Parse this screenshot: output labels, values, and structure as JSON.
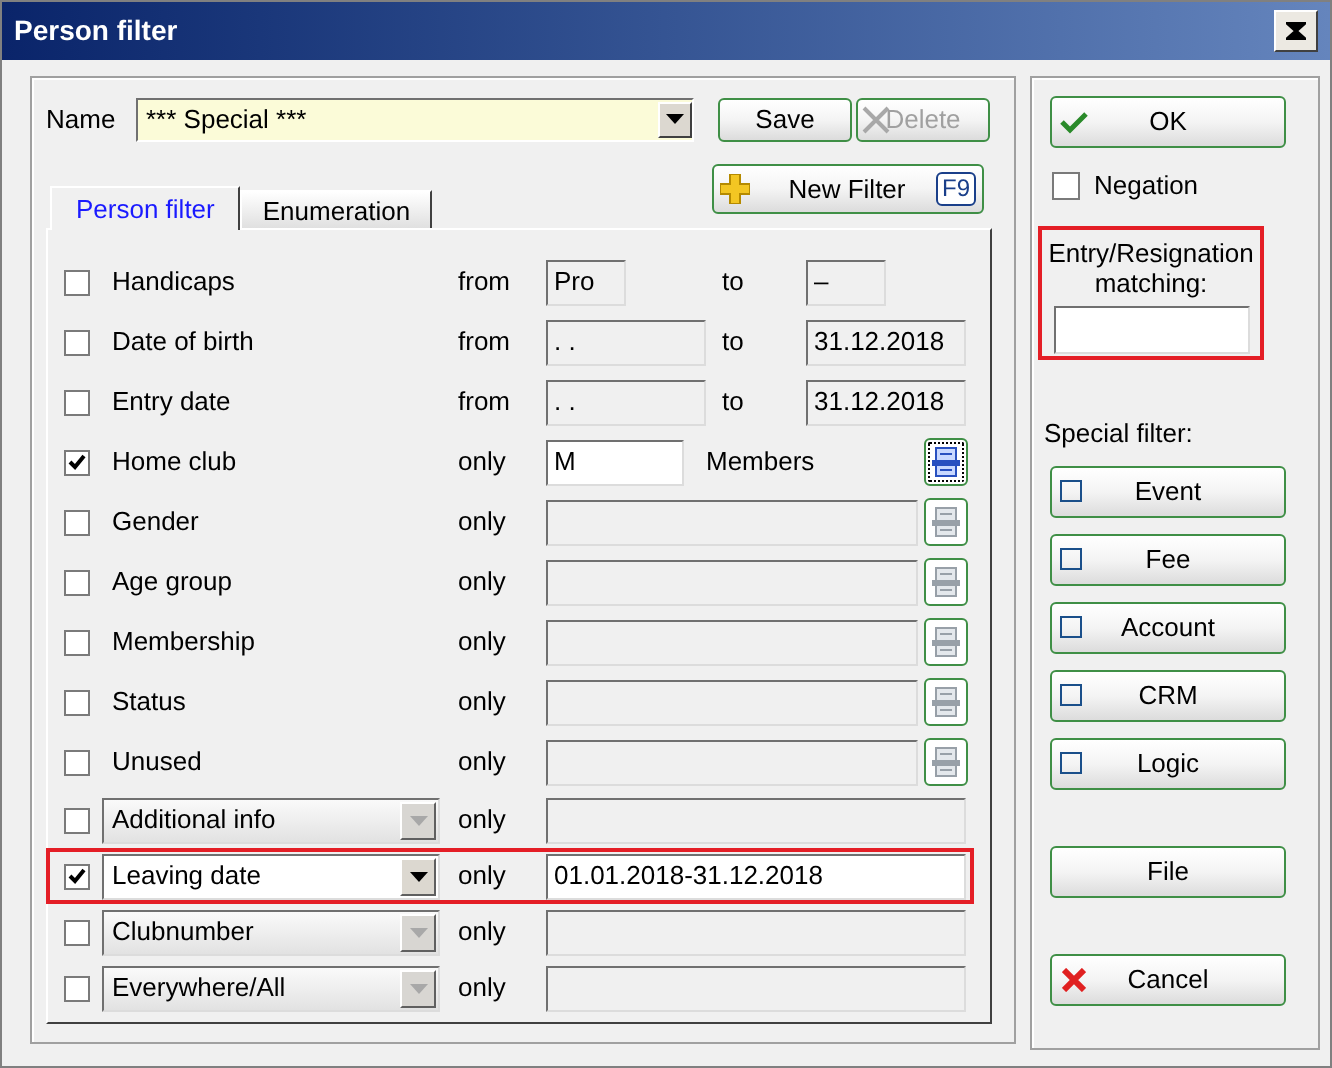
{
  "window": {
    "title": "Person filter"
  },
  "name_field": {
    "label": "Name",
    "value": "*** Special ***"
  },
  "top_buttons": [
    {
      "label": "Save",
      "disabled": false
    },
    {
      "label": "Delete",
      "disabled": true
    }
  ],
  "new_filter": {
    "label": "New Filter",
    "shortcut": "F9"
  },
  "tabs": [
    {
      "label": "Person filter",
      "selected": true
    },
    {
      "label": "Enumeration",
      "selected": false
    }
  ],
  "rows": [
    {
      "kind": "number_range",
      "checked": false,
      "highlighted": false,
      "label": "Handicaps",
      "op": "from",
      "from_value": "Pro",
      "to_label": "to",
      "to_value": "–"
    },
    {
      "kind": "date_range",
      "checked": false,
      "highlighted": false,
      "label": "Date of birth",
      "op": "from",
      "from_value": ". .",
      "to_label": "to",
      "to_value": "31.12.2018"
    },
    {
      "kind": "date_range",
      "checked": false,
      "highlighted": false,
      "label": "Entry date",
      "op": "from",
      "from_value": ". .",
      "to_label": "to",
      "to_value": "31.12.2018"
    },
    {
      "kind": "list",
      "checked": true,
      "highlighted": false,
      "label": "Home club",
      "op": "only",
      "value": "M",
      "suffix": "Members"
    },
    {
      "kind": "list",
      "checked": false,
      "highlighted": false,
      "label": "Gender",
      "op": "only"
    },
    {
      "kind": "list",
      "checked": false,
      "highlighted": false,
      "label": "Age group",
      "op": "only"
    },
    {
      "kind": "list",
      "checked": false,
      "highlighted": false,
      "label": "Membership",
      "op": "only"
    },
    {
      "kind": "list",
      "checked": false,
      "highlighted": false,
      "label": "Status",
      "op": "only"
    },
    {
      "kind": "list",
      "checked": false,
      "highlighted": false,
      "label": "Unused",
      "op": "only"
    },
    {
      "kind": "combo",
      "checked": false,
      "highlighted": false,
      "label": "Additional info",
      "op": "only"
    },
    {
      "kind": "combo",
      "checked": true,
      "highlighted": true,
      "label": "Leaving date",
      "op": "only",
      "value": "01.01.2018-31.12.2018"
    },
    {
      "kind": "combo",
      "checked": false,
      "highlighted": false,
      "label": "Clubnumber",
      "op": "only"
    },
    {
      "kind": "combo",
      "checked": false,
      "highlighted": false,
      "label": "Everywhere/All",
      "op": "only"
    }
  ],
  "ok_button": {
    "label": "OK"
  },
  "negation": {
    "label": "Negation",
    "checked": false
  },
  "entry_resignation": {
    "label": "Entry/Resignation matching:",
    "highlighted": true
  },
  "special_filter": {
    "label": "Special filter:",
    "items": [
      {
        "label": "Event",
        "checked": false
      },
      {
        "label": "Fee",
        "checked": false
      },
      {
        "label": "Account",
        "checked": false
      },
      {
        "label": "CRM",
        "checked": false
      },
      {
        "label": "Logic",
        "checked": false
      }
    ]
  },
  "file_button": {
    "label": "File"
  },
  "cancel_button": {
    "label": "Cancel"
  }
}
